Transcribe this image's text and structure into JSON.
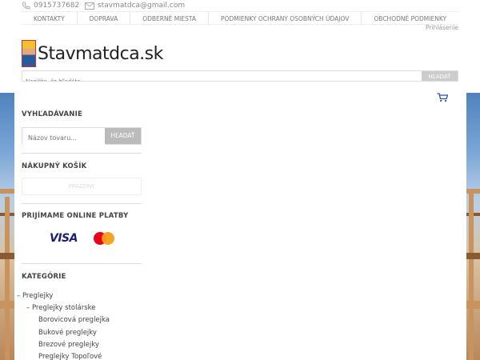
{
  "header": {
    "phone": "0915737682",
    "email": "stavmatdca@gmail.com",
    "login": "Prihlásenie",
    "nav": [
      "KONTAKTY",
      "DOPRAVA",
      "ODBERNÉ MIESTA",
      "PODMIENKY OCHRANY OSOBNÝCH ÚDAJOV",
      "OBCHODNÉ PODMIENKY"
    ],
    "logo_text": "Stavmatdca.sk",
    "search_placeholder": "Napíšte, čo hľadáte",
    "search_button": "HĽADAŤ"
  },
  "sidebar": {
    "search_title": "VYHĽADÁVANIE",
    "search_placeholder": "Názov tovaru...",
    "search_button": "HĽADAŤ",
    "cart_title": "NÁKUPNÝ KOŠÍK",
    "cart_state": "PRÁZDNY",
    "payments_title": "PRIJÍMAME ONLINE PLATBY",
    "visa": "VISA",
    "categories_title": "KATEGÓRIE",
    "categories": [
      {
        "label": "–  Preglejky",
        "level": 1
      },
      {
        "label": "–  Preglejky stolárske",
        "level": 2
      },
      {
        "label": "Borovicová preglejka",
        "level": 3
      },
      {
        "label": "Bukové preglejky",
        "level": 3
      },
      {
        "label": "Brezové preglejky",
        "level": 3
      },
      {
        "label": "Preglejky Topoľové",
        "level": 3
      }
    ]
  },
  "colors": {
    "visa_blue": "#1a1f71",
    "mastercard_red": "#eb001b",
    "mastercard_orange": "#f79e1b"
  },
  "icons": {
    "phone": "phone-icon",
    "mail": "mail-icon",
    "cart": "cart-icon"
  }
}
